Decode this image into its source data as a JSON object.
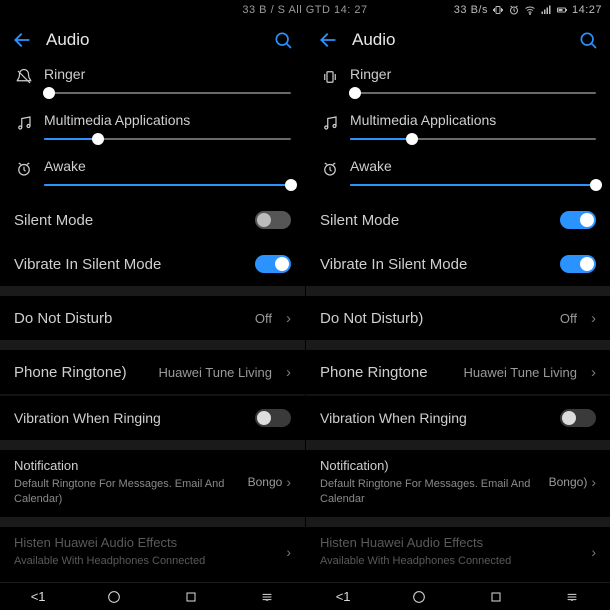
{
  "statusbar": {
    "center": "33 B / S All GTD 14: 27",
    "rate": "33 B/s",
    "time": "14:27"
  },
  "left": {
    "header": {
      "title": "Audio"
    },
    "sliders": {
      "ringer": {
        "label": "Ringer",
        "pct": 2
      },
      "multimedia": {
        "label": "Multimedia Applications",
        "pct": 22
      },
      "awake": {
        "label": "Awake",
        "pct": 100
      }
    },
    "toggles": {
      "silent": {
        "label": "Silent Mode",
        "on": false
      },
      "vibsilent": {
        "label": "Vibrate In Silent Mode",
        "on": true
      },
      "vibring": {
        "label": "Vibration When Ringing",
        "on": false
      }
    },
    "links": {
      "dnd": {
        "label": "Do Not Disturb",
        "value": "Off"
      },
      "ringtone": {
        "label": "Phone Ringtone)",
        "value": "Huawei Tune Living"
      }
    },
    "notif": {
      "title": "Notification",
      "desc": "Default Ringtone For Messages. Email And Calendar)",
      "value": "Bongo"
    },
    "histen": {
      "title": "Histen Huawei Audio Effects",
      "desc": "Available With Headphones Connected"
    }
  },
  "right": {
    "header": {
      "title": "Audio"
    },
    "sliders": {
      "ringer": {
        "label": "Ringer",
        "pct": 2
      },
      "multimedia": {
        "label": "Multimedia Applications",
        "pct": 25
      },
      "awake": {
        "label": "Awake",
        "pct": 100
      }
    },
    "toggles": {
      "silent": {
        "label": "Silent Mode",
        "on": true
      },
      "vibsilent": {
        "label": "Vibrate In Silent Mode",
        "on": true
      },
      "vibring": {
        "label": "Vibration When Ringing",
        "on": false
      }
    },
    "links": {
      "dnd": {
        "label": "Do Not Disturb)",
        "value": "Off"
      },
      "ringtone": {
        "label": "Phone Ringtone",
        "value": "Huawei Tune Living"
      }
    },
    "notif": {
      "title": "Notification)",
      "desc": "Default Ringtone For Messages. Email And Calendar",
      "value": "Bongo)"
    },
    "histen": {
      "title": "Histen Huawei Audio Effects",
      "desc": "Available With Headphones Connected"
    }
  },
  "nav": {
    "left": "<1",
    "left2": "<1"
  }
}
